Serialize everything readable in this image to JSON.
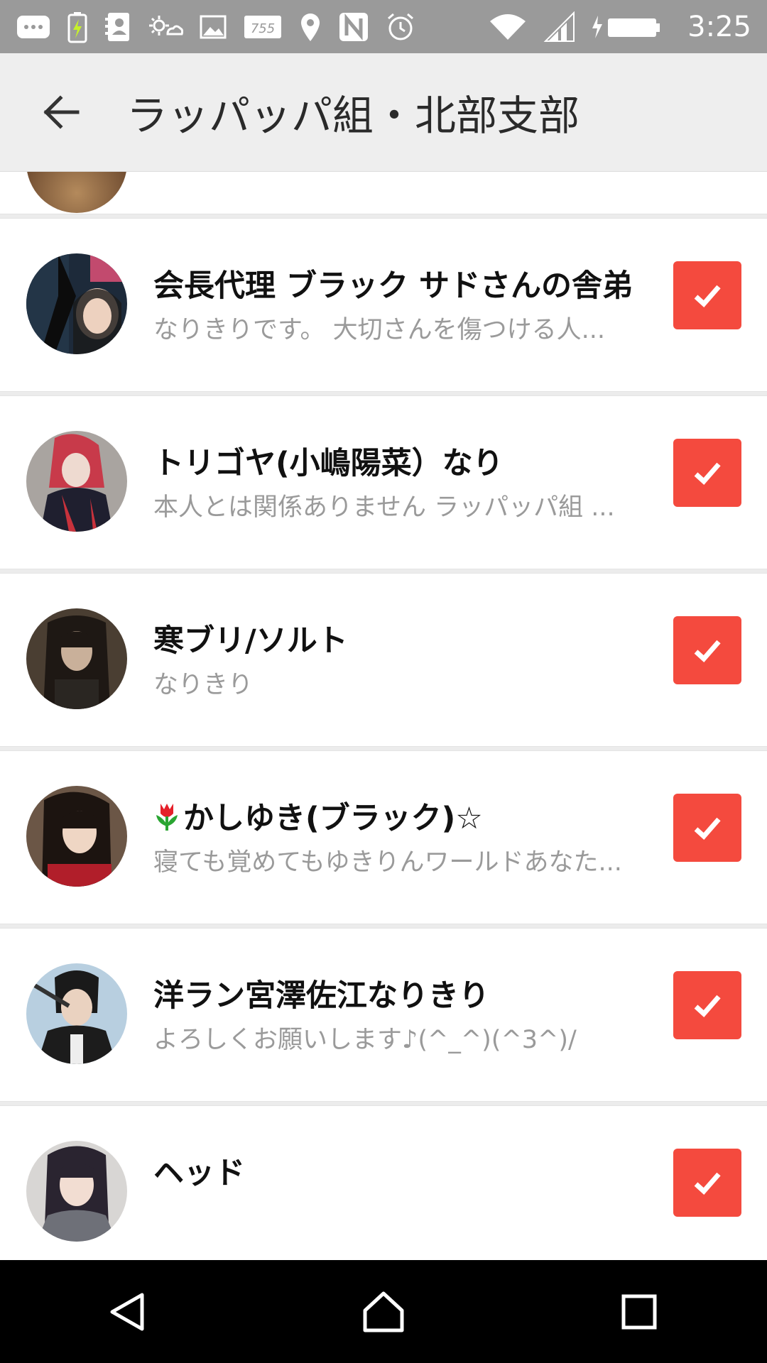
{
  "status_bar": {
    "time": "3:25",
    "icons": [
      "message-icon",
      "battery-charging-icon",
      "contacts-icon",
      "weather-icon",
      "image-icon",
      "carrier-icon",
      "location-icon",
      "nfc-icon",
      "alarm-icon",
      "wifi-icon",
      "signal-icon",
      "battery-icon"
    ],
    "carrier_badge": "755"
  },
  "app_bar": {
    "title": "ラッパッパ組・北部支部",
    "back_icon": "arrow-left-icon"
  },
  "members": [
    {
      "name": "会長代理 ブラック サドさんの舎弟",
      "description": "なりきりです。 大切さんを傷つける人...",
      "checked": true
    },
    {
      "name": "トリゴヤ(小嶋陽菜）なり",
      "description": "本人とは関係ありません ラッパッパ組 ...",
      "checked": true
    },
    {
      "name": "寒ブリ/ソルト",
      "description": "なりきり",
      "checked": true
    },
    {
      "name": "かしゆき(ブラック)☆",
      "name_prefix_icon": "tulip-icon",
      "description": "寝ても覚めてもゆきりんワールドあなた...",
      "checked": true
    },
    {
      "name": "洋ラン宮澤佐江なりきり",
      "description": "よろしくお願いします♪(^_^)(^3^)/",
      "checked": true
    },
    {
      "name": "ヘッド",
      "description": "",
      "checked": true
    }
  ],
  "colors": {
    "checkbox": "#f44a3e",
    "status_bar": "#9a9a9a",
    "app_bar": "#eeeeee"
  },
  "nav_bar": {
    "icons": [
      "back-triangle-icon",
      "home-icon",
      "recents-icon"
    ]
  }
}
